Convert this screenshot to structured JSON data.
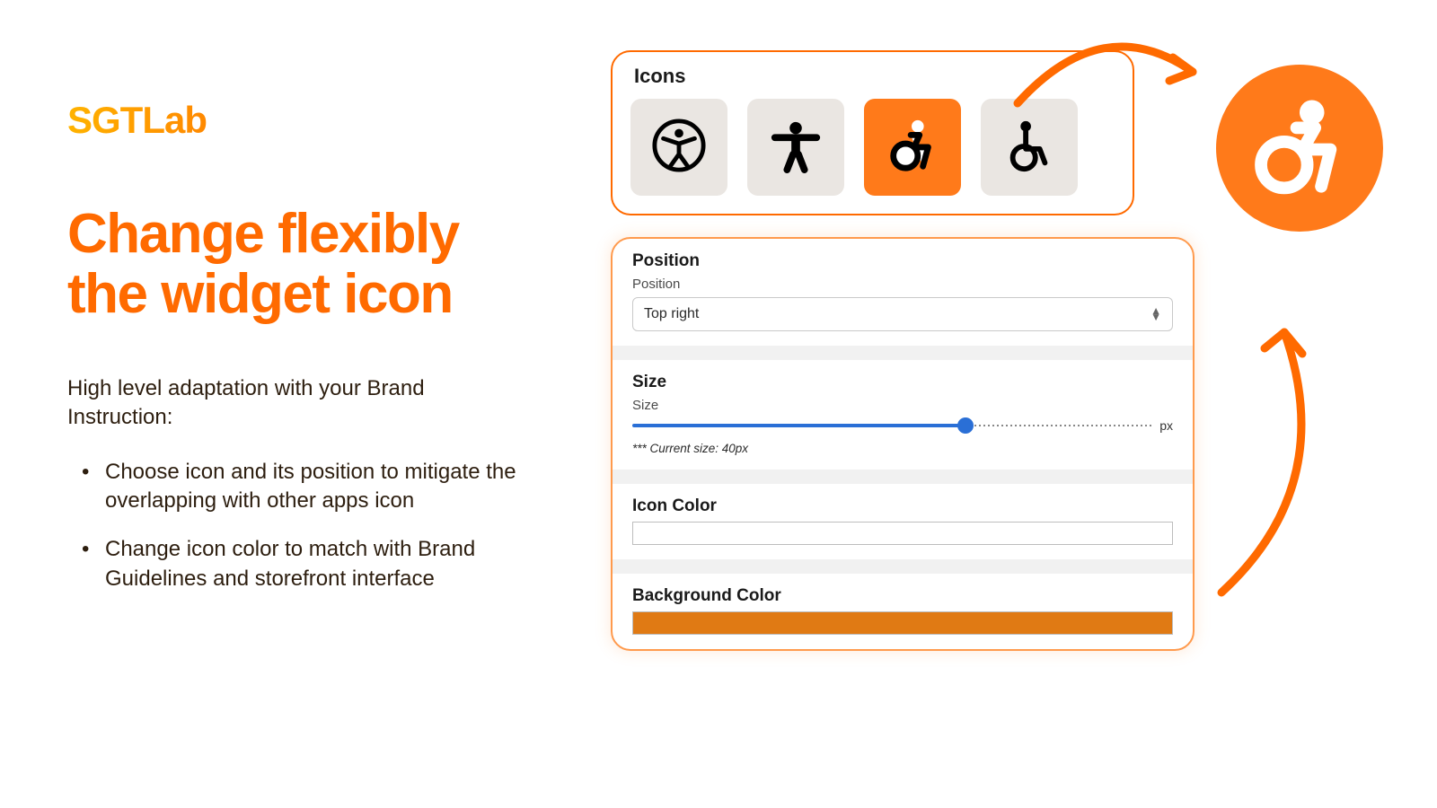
{
  "brand": {
    "logo_text": "SGTLab"
  },
  "headline": "Change flexibly the widget icon",
  "subhead": "High level adaptation with your Brand Instruction:",
  "bullets": [
    "Choose icon and its position to mitigate the overlapping with other apps icon",
    "Change icon color to match with Brand Guidelines and storefront interface"
  ],
  "icons_panel": {
    "title": "Icons",
    "options": [
      {
        "name": "accessibility-universal-icon",
        "selected": false
      },
      {
        "name": "accessibility-person-icon",
        "selected": false
      },
      {
        "name": "accessibility-wheelchair-motion-icon",
        "selected": true
      },
      {
        "name": "accessibility-wheelchair-icon",
        "selected": false
      }
    ]
  },
  "settings": {
    "position": {
      "section_title": "Position",
      "label": "Position",
      "value": "Top right"
    },
    "size": {
      "section_title": "Size",
      "label": "Size",
      "unit": "px",
      "note": "*** Current size: 40px",
      "value_percent": 64
    },
    "icon_color": {
      "section_title": "Icon Color",
      "value": "#ffffff"
    },
    "background_color": {
      "section_title": "Background Color",
      "value": "#e07a14"
    }
  },
  "preview": {
    "icon": "accessibility-wheelchair-motion-icon",
    "bg": "#ff7a1a"
  },
  "colors": {
    "accent": "#ff6a00",
    "slider": "#2a6fd6"
  }
}
